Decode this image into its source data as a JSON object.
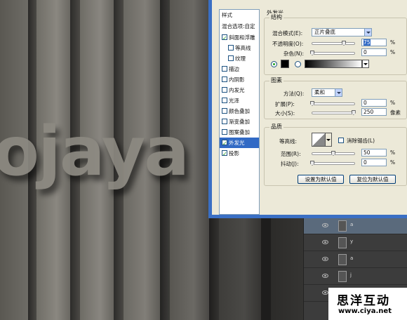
{
  "artwork": {
    "text": "ojaya"
  },
  "watermark": {
    "brand": "思洋互动",
    "url": "www.ciya.net"
  },
  "layers": [
    {
      "name": "a",
      "selected": true
    },
    {
      "name": "y",
      "selected": false
    },
    {
      "name": "a",
      "selected": false
    },
    {
      "name": "j",
      "selected": false
    },
    {
      "name": "",
      "selected": false
    }
  ],
  "styles_list": {
    "header": "样式",
    "blend_options": "混合选项:自定",
    "items": [
      {
        "label": "斜面和浮雕",
        "checked": true,
        "indent": false,
        "selected": false
      },
      {
        "label": "等高线",
        "checked": false,
        "indent": true,
        "selected": false
      },
      {
        "label": "纹理",
        "checked": false,
        "indent": true,
        "selected": false
      },
      {
        "label": "描边",
        "checked": false,
        "indent": false,
        "selected": false
      },
      {
        "label": "内阴影",
        "checked": false,
        "indent": false,
        "selected": false
      },
      {
        "label": "内发光",
        "checked": false,
        "indent": false,
        "selected": false
      },
      {
        "label": "光泽",
        "checked": false,
        "indent": false,
        "selected": false
      },
      {
        "label": "颜色叠加",
        "checked": false,
        "indent": false,
        "selected": false
      },
      {
        "label": "渐变叠加",
        "checked": false,
        "indent": false,
        "selected": false
      },
      {
        "label": "图案叠加",
        "checked": false,
        "indent": false,
        "selected": false
      },
      {
        "label": "外发光",
        "checked": true,
        "indent": false,
        "selected": true
      },
      {
        "label": "投影",
        "checked": true,
        "indent": false,
        "selected": false
      }
    ]
  },
  "outer_glow": {
    "title": "外发光",
    "structure": {
      "title": "结构",
      "blend_mode_label": "混合模式(E):",
      "blend_mode_value": "正片叠底",
      "opacity_label": "不透明度(O):",
      "opacity_value": "75",
      "opacity_fraction": 0.75,
      "noise_label": "杂色(N):",
      "noise_value": "0",
      "noise_fraction": 0.0,
      "percent": "%",
      "color_radio_selected": true,
      "glow_color": "#000000"
    },
    "elements": {
      "title": "图素",
      "technique_label": "方法(Q):",
      "technique_value": "柔和",
      "spread_label": "扩展(P):",
      "spread_value": "0",
      "spread_fraction": 0.0,
      "size_label": "大小(S):",
      "size_value": "250",
      "size_fraction": 0.98,
      "percent": "%",
      "pixels": "像素"
    },
    "quality": {
      "title": "品质",
      "contour_label": "等高线:",
      "antialias_label": "消除锯齿(L)",
      "antialias_checked": false,
      "range_label": "范围(R):",
      "range_value": "50",
      "range_fraction": 0.5,
      "jitter_label": "抖动(J):",
      "jitter_value": "0",
      "jitter_fraction": 0.0,
      "percent": "%"
    },
    "buttons": {
      "make_default": "设置为默认值",
      "reset_default": "复位为默认值"
    }
  }
}
